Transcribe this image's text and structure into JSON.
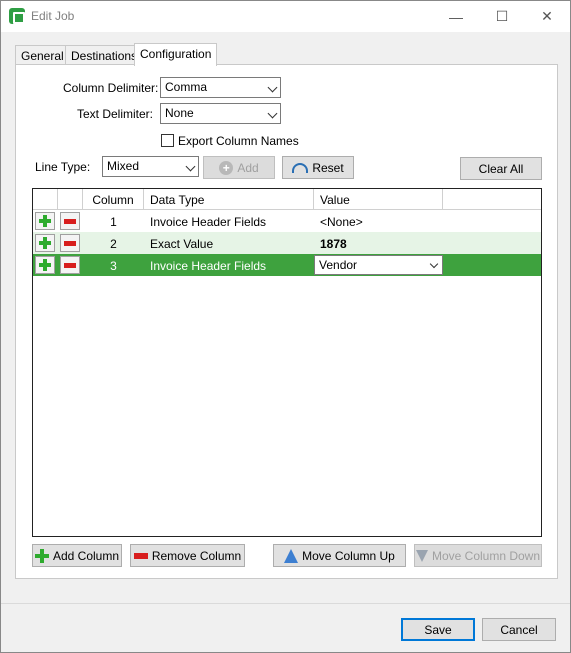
{
  "window": {
    "title": "Edit Job",
    "minimize_label": "—",
    "maximize_label": "☐",
    "close_label": "✕"
  },
  "tabs": [
    {
      "label": "General"
    },
    {
      "label": "Destinations"
    },
    {
      "label": "Configuration"
    }
  ],
  "config": {
    "column_delimiter_label": "Column Delimiter:",
    "column_delimiter_value": "Comma",
    "text_delimiter_label": "Text Delimiter:",
    "text_delimiter_value": "None",
    "export_column_names_label": "Export Column Names",
    "line_type_label": "Line Type:",
    "line_type_value": "Mixed",
    "add_label": "Add",
    "reset_label": "Reset",
    "clear_all_label": "Clear All"
  },
  "grid": {
    "headers": [
      "Column",
      "Data Type",
      "Value"
    ],
    "rows": [
      {
        "column": "1",
        "data_type": "Invoice Header Fields",
        "value": "<None>"
      },
      {
        "column": "2",
        "data_type": "Exact Value",
        "value": "1878"
      },
      {
        "column": "3",
        "data_type": "Invoice Header Fields",
        "value": "Vendor"
      }
    ]
  },
  "bottom_buttons": {
    "add_column": "Add Column",
    "remove_column": "Remove Column",
    "move_up": "Move Column Up",
    "move_down": "Move Column Down"
  },
  "dialog": {
    "save": "Save",
    "cancel": "Cancel"
  }
}
